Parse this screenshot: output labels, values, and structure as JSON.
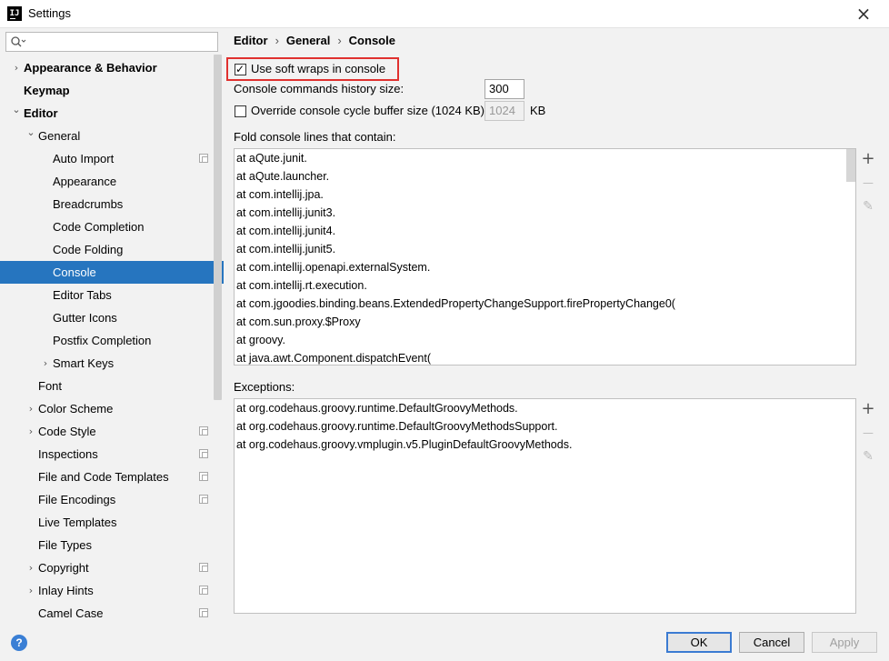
{
  "window": {
    "title": "Settings",
    "app_icon": "IJ"
  },
  "search": {
    "placeholder": ""
  },
  "sidebar": {
    "items": [
      {
        "label": "Appearance & Behavior",
        "bold": true,
        "indent": 0,
        "expander": "right",
        "project": false,
        "selected": false
      },
      {
        "label": "Keymap",
        "bold": true,
        "indent": 0,
        "expander": "none",
        "project": false,
        "selected": false
      },
      {
        "label": "Editor",
        "bold": true,
        "indent": 0,
        "expander": "down",
        "project": false,
        "selected": false
      },
      {
        "label": "General",
        "bold": false,
        "indent": 1,
        "expander": "down",
        "project": false,
        "selected": false
      },
      {
        "label": "Auto Import",
        "bold": false,
        "indent": 2,
        "expander": "none",
        "project": true,
        "selected": false
      },
      {
        "label": "Appearance",
        "bold": false,
        "indent": 2,
        "expander": "none",
        "project": false,
        "selected": false
      },
      {
        "label": "Breadcrumbs",
        "bold": false,
        "indent": 2,
        "expander": "none",
        "project": false,
        "selected": false
      },
      {
        "label": "Code Completion",
        "bold": false,
        "indent": 2,
        "expander": "none",
        "project": false,
        "selected": false
      },
      {
        "label": "Code Folding",
        "bold": false,
        "indent": 2,
        "expander": "none",
        "project": false,
        "selected": false
      },
      {
        "label": "Console",
        "bold": false,
        "indent": 2,
        "expander": "none",
        "project": false,
        "selected": true
      },
      {
        "label": "Editor Tabs",
        "bold": false,
        "indent": 2,
        "expander": "none",
        "project": false,
        "selected": false
      },
      {
        "label": "Gutter Icons",
        "bold": false,
        "indent": 2,
        "expander": "none",
        "project": false,
        "selected": false
      },
      {
        "label": "Postfix Completion",
        "bold": false,
        "indent": 2,
        "expander": "none",
        "project": false,
        "selected": false
      },
      {
        "label": "Smart Keys",
        "bold": false,
        "indent": 2,
        "expander": "right",
        "project": false,
        "selected": false
      },
      {
        "label": "Font",
        "bold": false,
        "indent": 1,
        "expander": "none",
        "project": false,
        "selected": false
      },
      {
        "label": "Color Scheme",
        "bold": false,
        "indent": 1,
        "expander": "right",
        "project": false,
        "selected": false
      },
      {
        "label": "Code Style",
        "bold": false,
        "indent": 1,
        "expander": "right",
        "project": true,
        "selected": false
      },
      {
        "label": "Inspections",
        "bold": false,
        "indent": 1,
        "expander": "none",
        "project": true,
        "selected": false
      },
      {
        "label": "File and Code Templates",
        "bold": false,
        "indent": 1,
        "expander": "none",
        "project": true,
        "selected": false
      },
      {
        "label": "File Encodings",
        "bold": false,
        "indent": 1,
        "expander": "none",
        "project": true,
        "selected": false
      },
      {
        "label": "Live Templates",
        "bold": false,
        "indent": 1,
        "expander": "none",
        "project": false,
        "selected": false
      },
      {
        "label": "File Types",
        "bold": false,
        "indent": 1,
        "expander": "none",
        "project": false,
        "selected": false
      },
      {
        "label": "Copyright",
        "bold": false,
        "indent": 1,
        "expander": "right",
        "project": true,
        "selected": false
      },
      {
        "label": "Inlay Hints",
        "bold": false,
        "indent": 1,
        "expander": "right",
        "project": true,
        "selected": false
      },
      {
        "label": "Camel Case",
        "bold": false,
        "indent": 1,
        "expander": "none",
        "project": true,
        "selected": false
      }
    ]
  },
  "breadcrumb": [
    "Editor",
    "General",
    "Console"
  ],
  "console": {
    "soft_wraps_label": "Use soft wraps in console",
    "soft_wraps_checked": true,
    "history_label": "Console commands history size:",
    "history_value": "300",
    "override_label": "Override console cycle buffer size (1024 KB)",
    "override_checked": false,
    "buffer_value": "1024",
    "buffer_unit": "KB",
    "fold_label": "Fold console lines that contain:",
    "fold_lines": [
      "at aQute.junit.",
      "at aQute.launcher.",
      "at com.intellij.jpa.",
      "at com.intellij.junit3.",
      "at com.intellij.junit4.",
      "at com.intellij.junit5.",
      "at com.intellij.openapi.externalSystem.",
      "at com.intellij.rt.execution.",
      "at com.jgoodies.binding.beans.ExtendedPropertyChangeSupport.firePropertyChange0(",
      "at com.sun.proxy.$Proxy",
      "at groovy.",
      "at java.awt.Component.dispatchEvent("
    ],
    "exceptions_label": "Exceptions:",
    "exception_lines": [
      "at org.codehaus.groovy.runtime.DefaultGroovyMethods.",
      "at org.codehaus.groovy.runtime.DefaultGroovyMethodsSupport.",
      "at org.codehaus.groovy.vmplugin.v5.PluginDefaultGroovyMethods."
    ],
    "tools": {
      "add": "+",
      "remove": "—",
      "edit": "✎"
    }
  },
  "buttons": {
    "ok": "OK",
    "cancel": "Cancel",
    "apply": "Apply",
    "help": "?"
  },
  "colors": {
    "selection": "#2675bf",
    "highlight": "#e0312f",
    "primary_border": "#3b7bd2"
  },
  "icons": {
    "close": "×",
    "chevron_right": "›",
    "chevron_down": "⌄"
  }
}
